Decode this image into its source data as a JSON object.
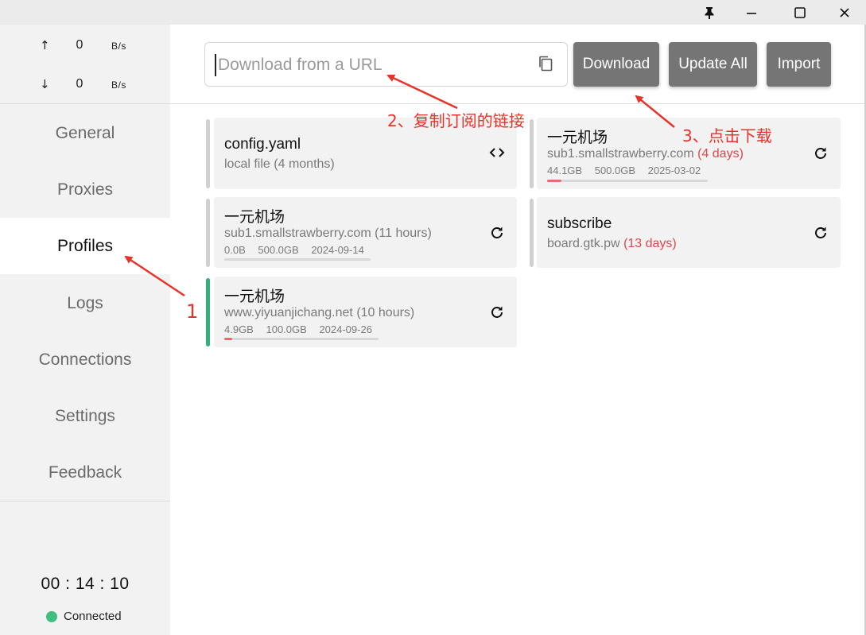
{
  "window": {
    "controls": [
      {
        "name": "pin",
        "icon": "pin-icon"
      },
      {
        "name": "minimize",
        "icon": "minimize-icon"
      },
      {
        "name": "maximize",
        "icon": "maximize-icon"
      },
      {
        "name": "close",
        "icon": "close-icon"
      }
    ]
  },
  "traffic": {
    "upload": {
      "arrow": "↑",
      "value": "0",
      "unit": "B/s"
    },
    "download": {
      "arrow": "↓",
      "value": "0",
      "unit": "B/s"
    }
  },
  "sidebar": {
    "items": [
      {
        "label": "General"
      },
      {
        "label": "Proxies"
      },
      {
        "label": "Profiles",
        "active": true
      },
      {
        "label": "Logs"
      },
      {
        "label": "Connections"
      },
      {
        "label": "Settings"
      },
      {
        "label": "Feedback"
      }
    ],
    "timer": "00 : 14 : 10",
    "status": "Connected",
    "status_color": "#3fbf7f"
  },
  "toolbar": {
    "url_placeholder": "Download from a URL",
    "url_value": "",
    "copy_icon": "copy-icon",
    "download_label": "Download",
    "update_all_label": "Update All",
    "import_label": "Import"
  },
  "profiles": [
    {
      "name": "config.yaml",
      "source": "local file",
      "age": "(4 months)",
      "age_red": false,
      "action_icon": "code-icon",
      "active": false
    },
    {
      "name": "一元机场",
      "source": "sub1.smallstrawberry.com",
      "age": "(4 days)",
      "age_red": true,
      "used": "44.1GB",
      "total": "500.0GB",
      "expire": "2025-03-02",
      "usage_fraction": 0.088,
      "action_icon": "refresh-icon",
      "active": false
    },
    {
      "name": "一元机场",
      "source": "sub1.smallstrawberry.com",
      "age": "(11 hours)",
      "age_red": false,
      "used": "0.0B",
      "total": "500.0GB",
      "expire": "2024-09-14",
      "usage_fraction": 0.0,
      "action_icon": "refresh-icon",
      "active": false
    },
    {
      "name": "subscribe",
      "source": "board.gtk.pw",
      "age": "(13 days)",
      "age_red": true,
      "action_icon": "refresh-icon",
      "active": false
    },
    {
      "name": "一元机场",
      "source": "www.yiyuanjichang.net",
      "age": "(10 hours)",
      "age_red": false,
      "used": "4.9GB",
      "total": "100.0GB",
      "expire": "2024-09-26",
      "usage_fraction": 0.049,
      "action_icon": "refresh-icon",
      "active": true
    }
  ],
  "annotations": {
    "step1": "1",
    "step2": "2、复制订阅的链接",
    "step3": "3、点击下载",
    "color": "#e8322a"
  },
  "colors": {
    "accent_active": "#35b07a",
    "button_bg": "#757575",
    "usage_bar": "#e86b73",
    "warning_text": "#e0454c"
  }
}
